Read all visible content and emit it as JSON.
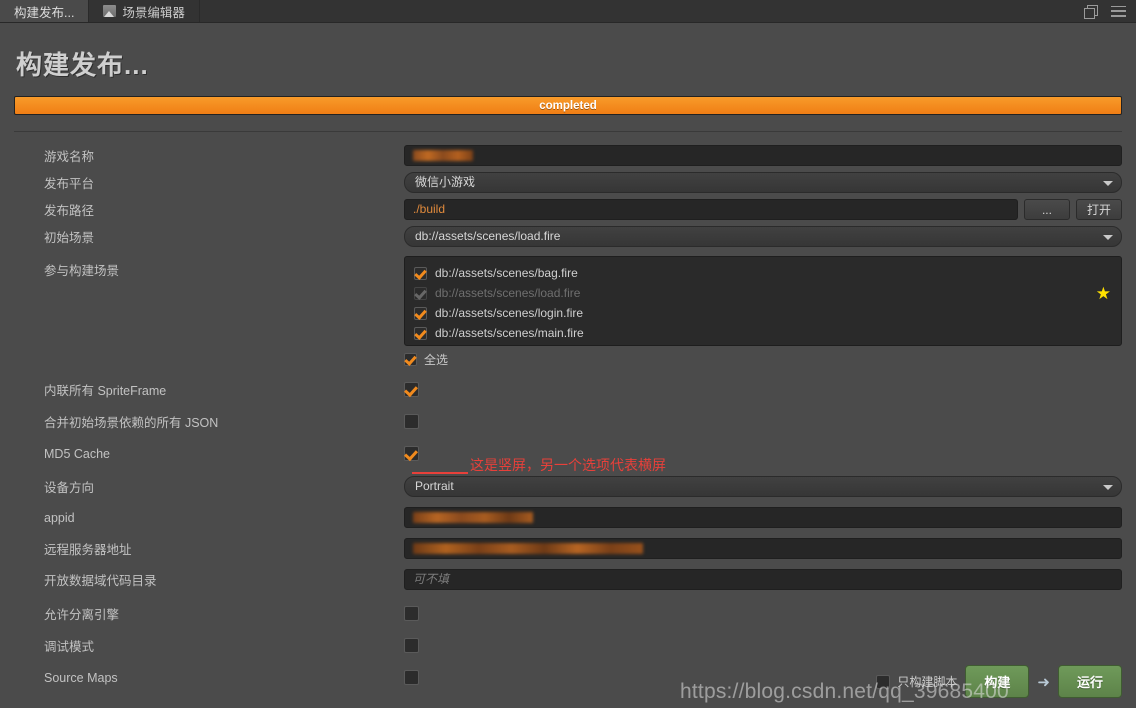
{
  "window": {
    "tabs": [
      {
        "label": "构建发布...",
        "active": true,
        "icon": "build-icon"
      },
      {
        "label": "场景编辑器",
        "active": false,
        "icon": "scene-editor-icon"
      }
    ],
    "controls": [
      {
        "name": "restore-window-icon"
      },
      {
        "name": "panel-menu-icon"
      }
    ]
  },
  "page": {
    "title": "构建发布...",
    "progress": {
      "percent": 100,
      "label": "completed",
      "color": "#f6921e"
    }
  },
  "form": {
    "game_name": {
      "label": "游戏名称",
      "value": "",
      "redacted": true
    },
    "platform": {
      "label": "发布平台",
      "value": "微信小游戏"
    },
    "publish_path": {
      "label": "发布路径",
      "value": "./build",
      "color": "#e08a3c",
      "browse_button": "...",
      "open_button": "打开"
    },
    "initial_scene": {
      "label": "初始场景",
      "value": "db://assets/scenes/load.fire"
    },
    "build_scenes": {
      "label": "参与构建场景",
      "items": [
        {
          "path": "db://assets/scenes/bag.fire",
          "checked": true,
          "disabled": false,
          "starred": false
        },
        {
          "path": "db://assets/scenes/load.fire",
          "checked": true,
          "disabled": true,
          "starred": true
        },
        {
          "path": "db://assets/scenes/login.fire",
          "checked": true,
          "disabled": false,
          "starred": false
        },
        {
          "path": "db://assets/scenes/main.fire",
          "checked": true,
          "disabled": false,
          "starred": false
        }
      ],
      "select_all_label": "全选",
      "select_all_checked": true,
      "star_icon": "★"
    },
    "inline_spriteframe": {
      "label": "内联所有 SpriteFrame",
      "checked": true
    },
    "merge_json": {
      "label": "合并初始场景依赖的所有 JSON",
      "checked": false
    },
    "md5_cache": {
      "label": "MD5 Cache",
      "checked": true
    },
    "orientation": {
      "label": "设备方向",
      "value": "Portrait"
    },
    "appid": {
      "label": "appid",
      "value": "",
      "redacted": true
    },
    "remote_server": {
      "label": "远程服务器地址",
      "value": "",
      "redacted": true
    },
    "open_data_dir": {
      "label": "开放数据域代码目录",
      "value": "",
      "placeholder": "可不填"
    },
    "separate_engine": {
      "label": "允许分离引擎",
      "checked": false
    },
    "debug_mode": {
      "label": "调试模式",
      "checked": false
    },
    "source_maps": {
      "label": "Source Maps",
      "checked": false
    }
  },
  "annotation": {
    "text": "这是竖屏，另一个选项代表横屏",
    "color": "#e8403a"
  },
  "footer": {
    "only_build_script": {
      "label": "只构建脚本",
      "checked": false
    },
    "build_button": "构建",
    "run_button": "运行",
    "arrow": "➜",
    "button_color": "#6f9a5a"
  },
  "watermark": {
    "text": "https://blog.csdn.net/qq_39685400"
  }
}
